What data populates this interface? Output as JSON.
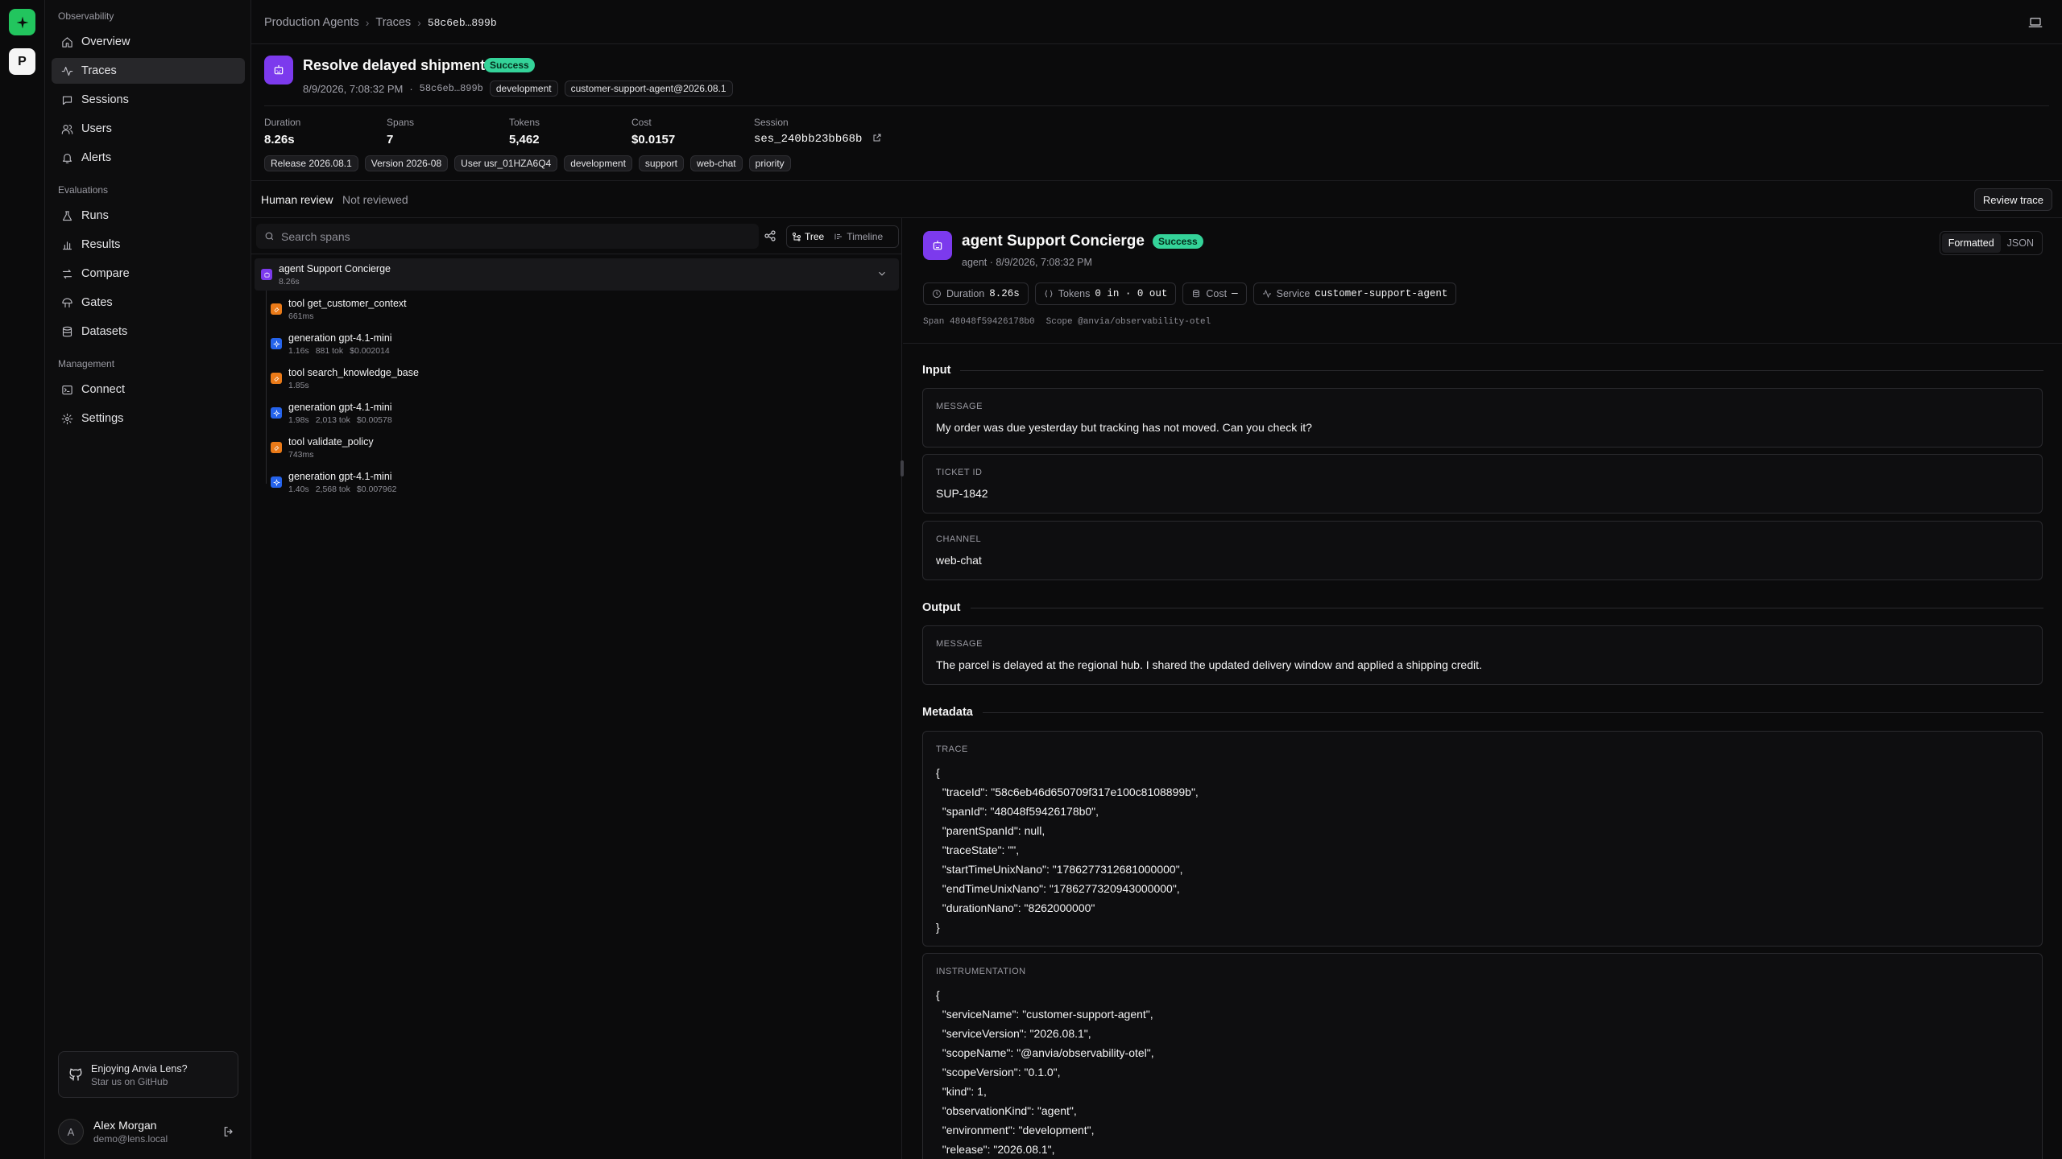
{
  "sidebar": {
    "workspace_initial": "P",
    "sections": [
      {
        "label": "Observability"
      },
      {
        "label": "Evaluations"
      },
      {
        "label": "Management"
      }
    ],
    "items": [
      {
        "label": "Overview",
        "icon": "home-icon"
      },
      {
        "label": "Traces",
        "icon": "activity-icon"
      },
      {
        "label": "Sessions",
        "icon": "chat-icon"
      },
      {
        "label": "Users",
        "icon": "users-icon"
      },
      {
        "label": "Alerts",
        "icon": "bell-icon"
      },
      {
        "label": "Runs",
        "icon": "flask-icon"
      },
      {
        "label": "Results",
        "icon": "bar-chart-icon"
      },
      {
        "label": "Compare",
        "icon": "compare-icon"
      },
      {
        "label": "Gates",
        "icon": "gate-icon"
      },
      {
        "label": "Datasets",
        "icon": "database-icon"
      },
      {
        "label": "Connect",
        "icon": "terminal-icon"
      },
      {
        "label": "Settings",
        "icon": "gear-icon"
      }
    ],
    "promo": {
      "title": "Enjoying Anvia Lens?",
      "subtitle": "Star us on GitHub"
    },
    "user": {
      "initial": "A",
      "name": "Alex Morgan",
      "email": "demo@lens.local"
    }
  },
  "breadcrumb": {
    "root": "Production Agents",
    "section": "Traces",
    "current": "58c6eb…899b"
  },
  "trace": {
    "title": "Resolve delayed shipment",
    "status": "Success",
    "timestamp": "8/9/2026, 7:08:32 PM",
    "dot": "·",
    "short_id": "58c6eb…899b",
    "env_chip": "development",
    "agent_chip": "customer-support-agent@2026.08.1",
    "stats": {
      "duration_label": "Duration",
      "duration": "8.26s",
      "spans_label": "Spans",
      "spans": "7",
      "tokens_label": "Tokens",
      "tokens": "5,462",
      "cost_label": "Cost",
      "cost": "$0.0157",
      "session_label": "Session",
      "session": "ses_240bb23bb68b"
    },
    "tags": [
      "Release 2026.08.1",
      "Version 2026-08",
      "User usr_01HZA6Q4",
      "development",
      "support",
      "web-chat",
      "priority"
    ]
  },
  "review": {
    "label": "Human review",
    "state": "Not reviewed",
    "button": "Review trace"
  },
  "spans_panel": {
    "search_placeholder": "Search spans",
    "view_tree": "Tree",
    "view_timeline": "Timeline",
    "root": {
      "name": "agent Support Concierge",
      "meta": "8.26s"
    },
    "children": [
      {
        "kind": "tool",
        "name": "tool get_customer_context",
        "meta": [
          "661ms"
        ]
      },
      {
        "kind": "generation",
        "name": "generation gpt-4.1-mini",
        "meta": [
          "1.16s",
          "881 tok",
          "$0.002014"
        ]
      },
      {
        "kind": "tool",
        "name": "tool search_knowledge_base",
        "meta": [
          "1.85s"
        ]
      },
      {
        "kind": "generation",
        "name": "generation gpt-4.1-mini",
        "meta": [
          "1.98s",
          "2,013 tok",
          "$0.00578"
        ]
      },
      {
        "kind": "tool",
        "name": "tool validate_policy",
        "meta": [
          "743ms"
        ]
      },
      {
        "kind": "generation",
        "name": "generation gpt-4.1-mini",
        "meta": [
          "1.40s",
          "2,568 tok",
          "$0.007962"
        ]
      }
    ]
  },
  "detail": {
    "title": "agent Support Concierge",
    "status": "Success",
    "subtitle": "agent · 8/9/2026, 7:08:32 PM",
    "fmt_formatted": "Formatted",
    "fmt_json": "JSON",
    "pills": {
      "duration_label": "Duration",
      "duration": "8.26s",
      "tokens_label": "Tokens",
      "tokens": "0 in · 0 out",
      "cost_label": "Cost",
      "cost": "—",
      "service_label": "Service",
      "service": "customer-support-agent"
    },
    "span_line": "Span 48048f59426178b0",
    "scope_line": "Scope @anvia/observability-otel",
    "input_heading": "Input",
    "input": [
      {
        "key": "MESSAGE",
        "value": "My order was due yesterday but tracking has not moved. Can you check it?"
      },
      {
        "key": "TICKET ID",
        "value": "SUP-1842"
      },
      {
        "key": "CHANNEL",
        "value": "web-chat"
      }
    ],
    "output_heading": "Output",
    "output": [
      {
        "key": "MESSAGE",
        "value": "The parcel is delayed at the regional hub. I shared the updated delivery window and applied a shipping credit."
      }
    ],
    "metadata_heading": "Metadata",
    "trace_key": "TRACE",
    "trace_json": "{\n  \"traceId\": \"58c6eb46d650709f317e100c8108899b\",\n  \"spanId\": \"48048f59426178b0\",\n  \"parentSpanId\": null,\n  \"traceState\": \"\",\n  \"startTimeUnixNano\": \"1786277312681000000\",\n  \"endTimeUnixNano\": \"1786277320943000000\",\n  \"durationNano\": \"8262000000\"\n}",
    "instr_key": "INSTRUMENTATION",
    "instr_json": "{\n  \"serviceName\": \"customer-support-agent\",\n  \"serviceVersion\": \"2026.08.1\",\n  \"scopeName\": \"@anvia/observability-otel\",\n  \"scopeVersion\": \"0.1.0\",\n  \"kind\": 1,\n  \"observationKind\": \"agent\",\n  \"environment\": \"development\",\n  \"release\": \"2026.08.1\","
  },
  "colors": {
    "accent_green": "#22c55e",
    "success_badge": "#34d399",
    "agent": "#7c3aed",
    "tool": "#ea7a18",
    "generation": "#2563eb"
  }
}
